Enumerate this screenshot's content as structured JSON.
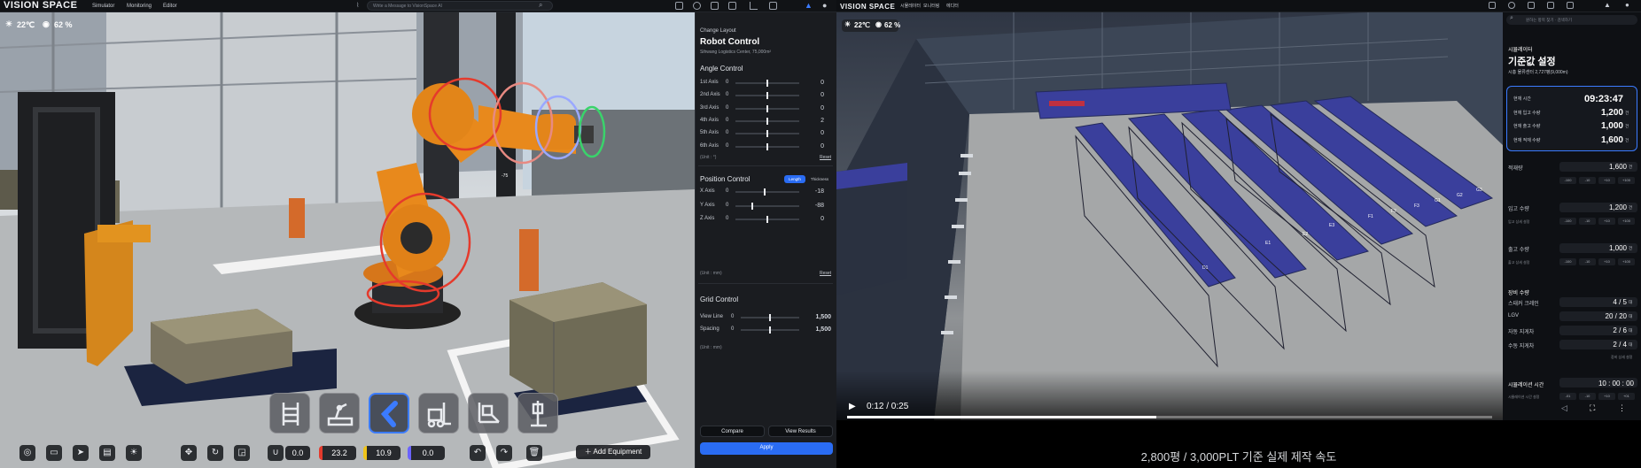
{
  "left_app": {
    "logo": "VISION SPACE",
    "menu": [
      "Simulator",
      "Monitoring",
      "Editor"
    ],
    "message_placeholder": "Write a Message to VisionSpace AI",
    "weather": {
      "temperature": "22℃",
      "humidity": "62 %"
    },
    "scene": {
      "annotation": "-75"
    },
    "panel": {
      "header": "Change Layout",
      "title": "Robot Control",
      "subtitle": "Sihwang Logistics Center, 75,000m²",
      "angle_control": {
        "title": "Angle Control",
        "rows": [
          {
            "label": "1st Axis",
            "min": "0",
            "value": "0"
          },
          {
            "label": "2nd Axis",
            "min": "0",
            "value": "0"
          },
          {
            "label": "3rd Axis",
            "min": "0",
            "value": "0"
          },
          {
            "label": "4th Axis",
            "min": "0",
            "value": "2"
          },
          {
            "label": "5th Axis",
            "min": "0",
            "value": "0"
          },
          {
            "label": "6th Axis",
            "min": "0",
            "value": "0"
          }
        ],
        "unit": "(Unit : °)",
        "reset": "Reset"
      },
      "position_control": {
        "title": "Position Control",
        "toggle": [
          "Length",
          "Thickness"
        ],
        "rows": [
          {
            "label": "X Axis",
            "min": "0",
            "value": "-18"
          },
          {
            "label": "Y Axis",
            "min": "0",
            "value": "-88"
          },
          {
            "label": "Z Axis",
            "min": "0",
            "value": "0"
          }
        ],
        "unit": "(Unit : mm)",
        "reset": "Reset"
      },
      "grid_control": {
        "title": "Grid Control",
        "rows": [
          {
            "label": "View Line",
            "min": "0",
            "value": "1,500"
          },
          {
            "label": "Spacing",
            "min": "0",
            "value": "1,500"
          }
        ],
        "unit": "(Unit : mm)"
      },
      "buttons": {
        "compare": "Compare",
        "view_results": "View Results",
        "apply": "Apply"
      }
    },
    "toolbar": {
      "equipment": [
        "rack-icon",
        "conveyor-robot-icon",
        "robot-arm-icon",
        "forklift-icon",
        "pallet-robot-icon",
        "stacker-icon"
      ],
      "selected_index": 2,
      "readouts": {
        "magnet": "0.0",
        "red": "23.2",
        "yellow": "10.9",
        "blue": "0.0"
      },
      "add_equipment": "Add Equipment"
    }
  },
  "right_app": {
    "logo": "VISION SPACE",
    "menu": [
      "시뮬레이터",
      "모니터링",
      "에디터"
    ],
    "search_placeholder": "원하는 항목 찾기 · 검색하기",
    "weather": {
      "temperature": "22℃",
      "humidity": "62 %"
    },
    "rack_labels": [
      "D1",
      "E1",
      "E2",
      "E3",
      "F1",
      "F2",
      "F3",
      "G1",
      "G2",
      "G3"
    ],
    "video": {
      "time": "0:12 / 0:25",
      "progress": 0.48
    },
    "caption": "2,800평 / 3,000PLT 기준 실제 제작 속도",
    "panel": {
      "header": "시뮬레이터",
      "title": "기준값 설정",
      "subtitle": "시흥 물류센터 2,727평(9,000m)",
      "summary": [
        {
          "label": "현재 시간",
          "value": "09:23:47"
        },
        {
          "label": "현재 입고 수량",
          "value": "1,200",
          "unit": "건"
        },
        {
          "label": "현재 출고 수량",
          "value": "1,000",
          "unit": "건"
        },
        {
          "label": "현재 적재 수량",
          "value": "1,600",
          "unit": "건"
        }
      ],
      "fields": [
        {
          "label": "적재량",
          "value": "1,600",
          "unit": "건",
          "sub": ""
        },
        {
          "label": "입고 수량",
          "value": "1,200",
          "unit": "건",
          "sub": "입고 상세 설정"
        },
        {
          "label": "출고 수량",
          "value": "1,000",
          "unit": "건",
          "sub": "출고 상세 설정"
        }
      ],
      "steppers": [
        "-100",
        "-10",
        "+10",
        "+100"
      ],
      "equipment_title": "장비 수량",
      "equipment": [
        {
          "label": "스태커 크레인",
          "value": "4 / 5",
          "unit": "대"
        },
        {
          "label": "LGV",
          "value": "20 / 20",
          "unit": "대"
        },
        {
          "label": "자동 지게차",
          "value": "2 / 6",
          "unit": "대"
        },
        {
          "label": "수동 지게차",
          "value": "2 / 4",
          "unit": "대"
        }
      ],
      "equipment_detail": "장비 상세 설정",
      "sim_time_label": "시뮬레이션 시간",
      "sim_time_value": "10 : 00 : 00",
      "sim_time_sub": "시뮬레이션 시간 설정",
      "time_steppers": [
        "-01",
        "-10",
        "+10",
        "+01"
      ]
    }
  },
  "colors": {
    "accent": "#2a6cf3",
    "robot_orange": "#e8891c",
    "rack_blue": "#3a3f9c",
    "ring_red": "#e53a2c",
    "ring_green": "#3ad36b"
  }
}
